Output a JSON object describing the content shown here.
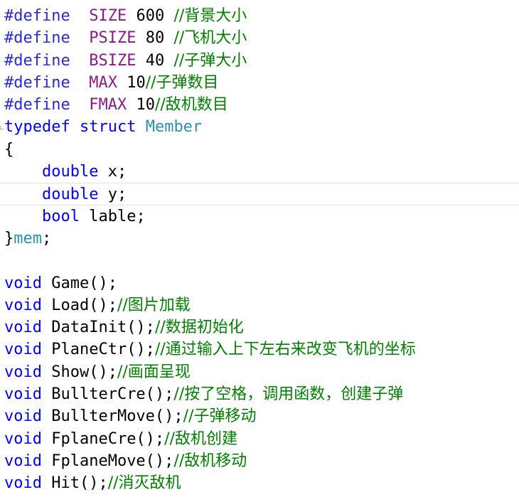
{
  "lines": [
    {
      "parts": [
        {
          "t": "#define",
          "c": "preproc"
        },
        {
          "t": "  ",
          "c": "plain"
        },
        {
          "t": "SIZE",
          "c": "macro"
        },
        {
          "t": " 600 ",
          "c": "num"
        },
        {
          "t": "//背景大小",
          "c": "comment"
        }
      ]
    },
    {
      "parts": [
        {
          "t": "#define",
          "c": "preproc"
        },
        {
          "t": "  ",
          "c": "plain"
        },
        {
          "t": "PSIZE",
          "c": "macro"
        },
        {
          "t": " 80 ",
          "c": "num"
        },
        {
          "t": "//飞机大小",
          "c": "comment"
        }
      ]
    },
    {
      "parts": [
        {
          "t": "#define",
          "c": "preproc"
        },
        {
          "t": "  ",
          "c": "plain"
        },
        {
          "t": "BSIZE",
          "c": "macro"
        },
        {
          "t": " 40 ",
          "c": "num"
        },
        {
          "t": "//子弹大小",
          "c": "comment"
        }
      ]
    },
    {
      "parts": [
        {
          "t": "#define",
          "c": "preproc"
        },
        {
          "t": "  ",
          "c": "plain"
        },
        {
          "t": "MAX",
          "c": "macro"
        },
        {
          "t": " 10",
          "c": "num"
        },
        {
          "t": "//子弹数目",
          "c": "comment"
        }
      ]
    },
    {
      "parts": [
        {
          "t": "#define",
          "c": "preproc"
        },
        {
          "t": "  ",
          "c": "plain"
        },
        {
          "t": "FMAX",
          "c": "macro"
        },
        {
          "t": " 10",
          "c": "num"
        },
        {
          "t": "//敌机数目",
          "c": "comment"
        }
      ]
    },
    {
      "fold": true,
      "parts": [
        {
          "t": "typedef",
          "c": "kw"
        },
        {
          "t": " ",
          "c": "plain"
        },
        {
          "t": "struct",
          "c": "kw"
        },
        {
          "t": " ",
          "c": "plain"
        },
        {
          "t": "Member",
          "c": "typename"
        }
      ]
    },
    {
      "parts": [
        {
          "t": "{",
          "c": "plain"
        }
      ]
    },
    {
      "parts": [
        {
          "t": "    ",
          "c": "plain"
        },
        {
          "t": "double",
          "c": "kw"
        },
        {
          "t": " x;",
          "c": "plain"
        }
      ]
    },
    {
      "current": true,
      "parts": [
        {
          "t": "    ",
          "c": "plain"
        },
        {
          "t": "double",
          "c": "kw"
        },
        {
          "t": " y;",
          "c": "plain"
        }
      ]
    },
    {
      "parts": [
        {
          "t": "    ",
          "c": "plain"
        },
        {
          "t": "bool",
          "c": "kw"
        },
        {
          "t": " lable;",
          "c": "plain"
        }
      ]
    },
    {
      "parts": [
        {
          "t": "}",
          "c": "plain"
        },
        {
          "t": "mem",
          "c": "typename"
        },
        {
          "t": ";",
          "c": "plain"
        }
      ]
    },
    {
      "parts": []
    },
    {
      "parts": [
        {
          "t": "void",
          "c": "kw"
        },
        {
          "t": " Game();",
          "c": "plain"
        }
      ]
    },
    {
      "parts": [
        {
          "t": "void",
          "c": "kw"
        },
        {
          "t": " Load();",
          "c": "plain"
        },
        {
          "t": "//图片加载",
          "c": "comment"
        }
      ]
    },
    {
      "parts": [
        {
          "t": "void",
          "c": "kw"
        },
        {
          "t": " DataInit();",
          "c": "plain"
        },
        {
          "t": "//数据初始化",
          "c": "comment"
        }
      ]
    },
    {
      "parts": [
        {
          "t": "void",
          "c": "kw"
        },
        {
          "t": " PlaneCtr();",
          "c": "plain"
        },
        {
          "t": "//通过输入上下左右来改变飞机的坐标",
          "c": "comment"
        }
      ]
    },
    {
      "parts": [
        {
          "t": "void",
          "c": "kw"
        },
        {
          "t": " Show();",
          "c": "plain"
        },
        {
          "t": "//画面呈现",
          "c": "comment"
        }
      ]
    },
    {
      "parts": [
        {
          "t": "void",
          "c": "kw"
        },
        {
          "t": " BullterCre();",
          "c": "plain"
        },
        {
          "t": "//按了空格，调用函数，创建子弹",
          "c": "comment"
        }
      ]
    },
    {
      "parts": [
        {
          "t": "void",
          "c": "kw"
        },
        {
          "t": " BullterMove();",
          "c": "plain"
        },
        {
          "t": "//子弹移动",
          "c": "comment"
        }
      ]
    },
    {
      "parts": [
        {
          "t": "void",
          "c": "kw"
        },
        {
          "t": " FplaneCre();",
          "c": "plain"
        },
        {
          "t": "//敌机创建",
          "c": "comment"
        }
      ]
    },
    {
      "parts": [
        {
          "t": "void",
          "c": "kw"
        },
        {
          "t": " FplaneMove();",
          "c": "plain"
        },
        {
          "t": "//敌机移动",
          "c": "comment"
        }
      ]
    },
    {
      "parts": [
        {
          "t": "void",
          "c": "kw"
        },
        {
          "t": " Hit();",
          "c": "plain"
        },
        {
          "t": "//消灭敌机",
          "c": "comment"
        }
      ]
    }
  ]
}
